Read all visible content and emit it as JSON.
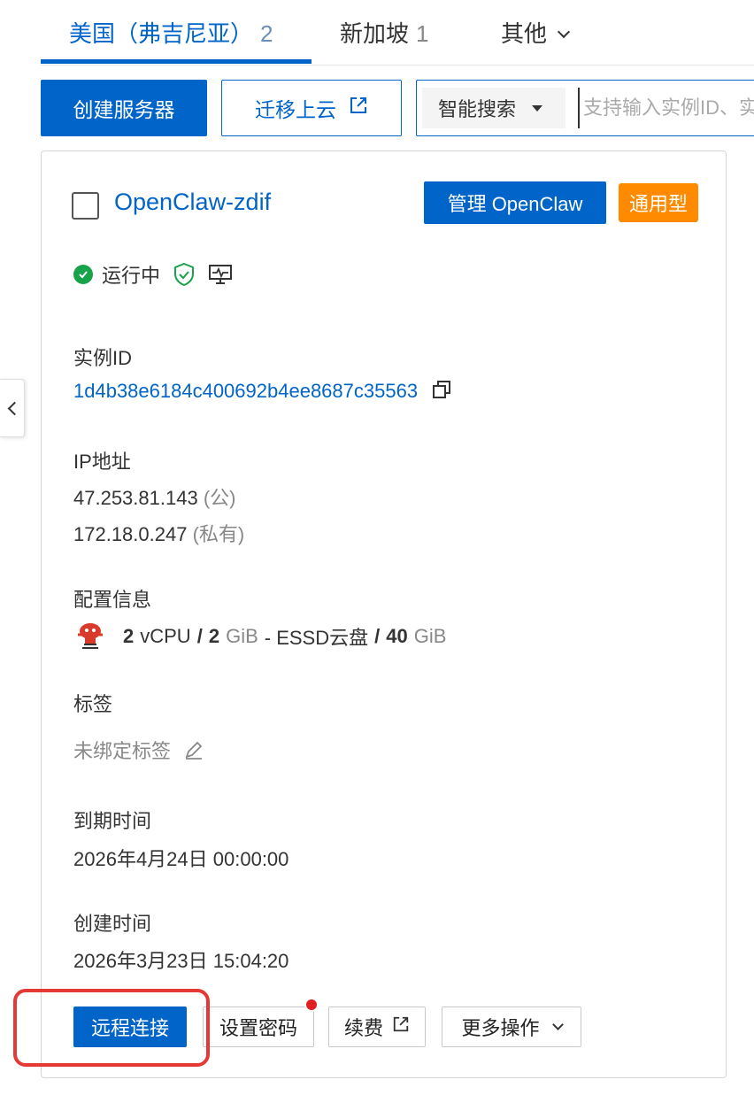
{
  "region_tabs": [
    {
      "label": "美国（弗吉尼亚）",
      "count": "2",
      "active": true
    },
    {
      "label": "新加坡",
      "count": "1",
      "active": false
    },
    {
      "label": "其他",
      "count": "",
      "active": false
    }
  ],
  "toolbar": {
    "create_label": "创建服务器",
    "migrate_label": "迁移上云",
    "search_type": "智能搜索",
    "search_placeholder": "支持输入实例ID、实例名称"
  },
  "instance": {
    "name": "OpenClaw-zdif",
    "manage_label": "管理 OpenClaw",
    "type_badge": "通用型",
    "status": "运行中",
    "id_label": "实例ID",
    "id": "1d4b38e6184c400692b4ee8687c35563",
    "ip_label": "IP地址",
    "public_ip": "47.253.81.143",
    "public_tag": "(公)",
    "private_ip": "172.18.0.247",
    "private_tag": "(私有)",
    "config_label": "配置信息",
    "config": {
      "cpu": "2",
      "cpu_unit": "vCPU",
      "sep": "/",
      "mem": "2",
      "mem_unit": "GiB",
      "disk_type": "- ESSD云盘",
      "disk": "40",
      "disk_unit": "GiB"
    },
    "tag_label": "标签",
    "tag_value": "未绑定标签",
    "expire_label": "到期时间",
    "expire_value": "2026年4月24日 00:00:00",
    "created_label": "创建时间",
    "created_value": "2026年3月23日 15:04:20"
  },
  "actions": {
    "remote": "远程连接",
    "password": "设置密码",
    "renew": "续费",
    "more": "更多操作"
  },
  "colors": {
    "primary": "#0064c8",
    "badge": "#ff8a00",
    "running": "#16a34a",
    "highlight": "#e53935"
  },
  "icons": [
    "external-link-icon",
    "chevron-down-icon",
    "check-icon",
    "shield-icon",
    "monitor-icon",
    "copy-icon",
    "edit-icon",
    "chevron-left-icon",
    "os-logo-icon"
  ]
}
